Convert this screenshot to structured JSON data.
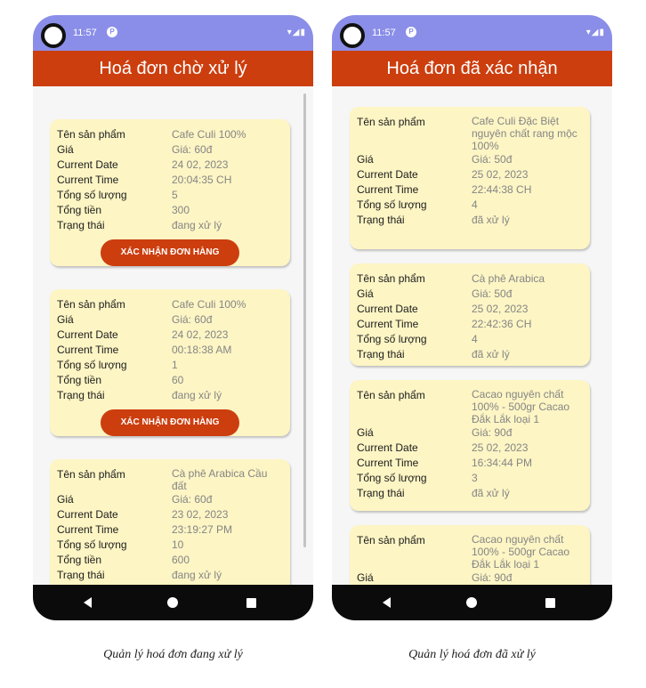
{
  "left": {
    "status_time": "11:57",
    "status_badge": "P",
    "title": "Hoá đơn chờ xử lý",
    "orders": [
      {
        "rows": [
          {
            "label": "Tên sản phẩm",
            "value": "Cafe Culi 100%"
          },
          {
            "label": "Giá",
            "value": "Giá: 60đ"
          },
          {
            "label": "Current Date",
            "value": "24 02, 2023"
          },
          {
            "label": "Current Time",
            "value": "20:04:35 CH"
          },
          {
            "label": "Tổng số lượng",
            "value": "5"
          },
          {
            "label": "Tổng tiền",
            "value": "300"
          },
          {
            "label": "Trạng thái",
            "value": "đang xử lý"
          }
        ],
        "button": "XÁC NHẬN ĐƠN HÀNG"
      },
      {
        "rows": [
          {
            "label": "Tên sản phẩm",
            "value": "Cafe Culi 100%"
          },
          {
            "label": "Giá",
            "value": "Giá: 60đ"
          },
          {
            "label": "Current Date",
            "value": "24 02, 2023"
          },
          {
            "label": "Current Time",
            "value": "00:18:38 AM"
          },
          {
            "label": "Tổng số lượng",
            "value": "1"
          },
          {
            "label": "Tổng tiền",
            "value": "60"
          },
          {
            "label": "Trạng thái",
            "value": "đang xử lý"
          }
        ],
        "button": "XÁC NHẬN ĐƠN HÀNG"
      },
      {
        "rows": [
          {
            "label": "Tên sản phẩm",
            "value": "Cà phê Arabica Cầu đất"
          },
          {
            "label": "Giá",
            "value": "Giá: 60đ"
          },
          {
            "label": "Current Date",
            "value": "23 02, 2023"
          },
          {
            "label": "Current Time",
            "value": "23:19:27 PM"
          },
          {
            "label": "Tổng số lượng",
            "value": "10"
          },
          {
            "label": "Tổng tiền",
            "value": "600"
          },
          {
            "label": "Trạng thái",
            "value": "đang xử lý"
          }
        ]
      }
    ]
  },
  "right": {
    "status_time": "11:57",
    "status_badge": "P",
    "title": "Hoá đơn đã xác nhận",
    "orders": [
      {
        "rows": [
          {
            "label": "Tên sản phẩm",
            "value": "Cafe Culi Đặc Biệt nguyên chất rang mộc 100%"
          },
          {
            "label": "Giá",
            "value": "Giá: 50đ"
          },
          {
            "label": "Current Date",
            "value": "25 02, 2023"
          },
          {
            "label": "Current Time",
            "value": "22:44:38 CH"
          },
          {
            "label": "Tổng số lượng",
            "value": "4"
          },
          {
            "label": "Trạng thái",
            "value": "đã xử lý"
          }
        ]
      },
      {
        "rows": [
          {
            "label": "Tên sản phẩm",
            "value": "Cà phê Arabica"
          },
          {
            "label": "Giá",
            "value": "Giá: 50đ"
          },
          {
            "label": "Current Date",
            "value": "25 02, 2023"
          },
          {
            "label": "Current Time",
            "value": "22:42:36 CH"
          },
          {
            "label": "Tổng số lượng",
            "value": "4"
          },
          {
            "label": "Trạng thái",
            "value": "đã xử lý"
          }
        ]
      },
      {
        "rows": [
          {
            "label": "Tên sản phẩm",
            "value": "Cacao nguyên chất 100% - 500gr Cacao Đắk Lắk loại 1"
          },
          {
            "label": "Giá",
            "value": "Giá: 90đ"
          },
          {
            "label": "Current Date",
            "value": "25 02, 2023"
          },
          {
            "label": "Current Time",
            "value": "16:34:44 PM"
          },
          {
            "label": "Tổng số lượng",
            "value": "3"
          },
          {
            "label": "Trạng thái",
            "value": "đã xử lý"
          }
        ]
      },
      {
        "rows": [
          {
            "label": "Tên sản phẩm",
            "value": "Cacao nguyên chất 100% - 500gr Cacao Đắk Lắk loại 1"
          },
          {
            "label": "Giá",
            "value": "Giá: 90đ"
          }
        ]
      }
    ]
  },
  "captions": {
    "left": "Quản lý hoá đơn đang xử lý",
    "right": "Quản lý hoá đơn đã xử lý"
  },
  "icons": {
    "status": [
      "wifi-icon",
      "signal-icon",
      "battery-icon"
    ],
    "nav": [
      "back-icon",
      "home-icon",
      "recents-icon"
    ]
  },
  "colors": {
    "status_bar": "#8a8ee8",
    "app_bar": "#cc3e0e",
    "card": "#fdf5c4",
    "value_text": "#858585"
  }
}
